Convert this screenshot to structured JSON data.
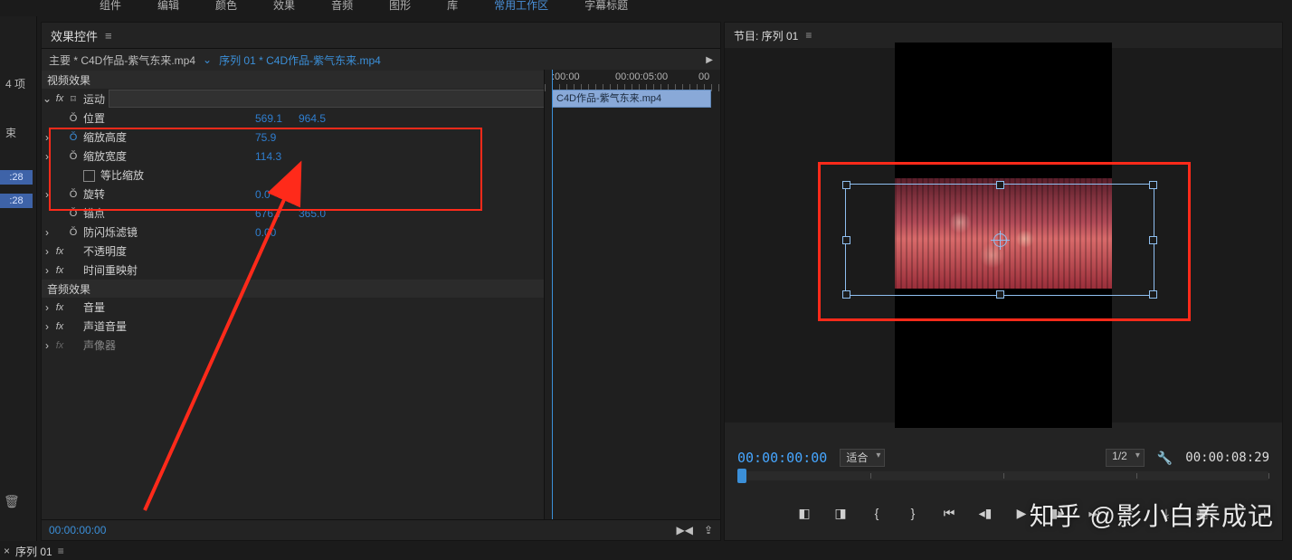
{
  "top_menu": {
    "items": [
      "组件",
      "编辑",
      "颜色",
      "效果",
      "音频",
      "图形",
      "库",
      "常用工作区",
      "字幕标题"
    ],
    "active_index": 7
  },
  "left_strip": {
    "count_label": "4 项",
    "pill": "束",
    "badge1": ":28",
    "badge2": ":28"
  },
  "effects_panel": {
    "title": "效果控件",
    "path_main": "主要 * C4D作品-紫气东来.mp4",
    "path_seq": "序列 01 * C4D作品-紫气东来.mp4",
    "section_video": "视频效果",
    "motion": {
      "label": "运动"
    },
    "props": {
      "position": {
        "label": "位置",
        "v1": "569.1",
        "v2": "964.5"
      },
      "scale_h": {
        "label": "缩放高度",
        "v": "75.9"
      },
      "scale_w": {
        "label": "缩放宽度",
        "v": "114.3"
      },
      "uniform": {
        "label": "等比缩放"
      },
      "rotation": {
        "label": "旋转",
        "v": "0.0"
      },
      "anchor": {
        "label": "锚点",
        "v1": "676.7",
        "v2": "365.0"
      },
      "antiflicker": {
        "label": "防闪烁滤镜",
        "v": "0.00"
      },
      "opacity": {
        "label": "不透明度"
      },
      "timeremap": {
        "label": "时间重映射"
      }
    },
    "section_audio": "音频效果",
    "audio": {
      "volume": "音量",
      "channel": "声道音量",
      "panner": "声像器"
    },
    "foot_time": "00:00:00:00"
  },
  "mini_timeline": {
    "t0": ":00:00",
    "t1": "00:00:05:00",
    "t2": "00",
    "clip": "C4D作品-紫气东来.mp4"
  },
  "program_panel": {
    "title": "节目: 序列 01",
    "tc_current": "00:00:00:00",
    "fit_label": "适合",
    "res_label": "1/2",
    "tc_total": "00:00:08:29"
  },
  "sequence_tab": {
    "label": "序列 01"
  },
  "watermark": "知乎  @影小白养成记"
}
